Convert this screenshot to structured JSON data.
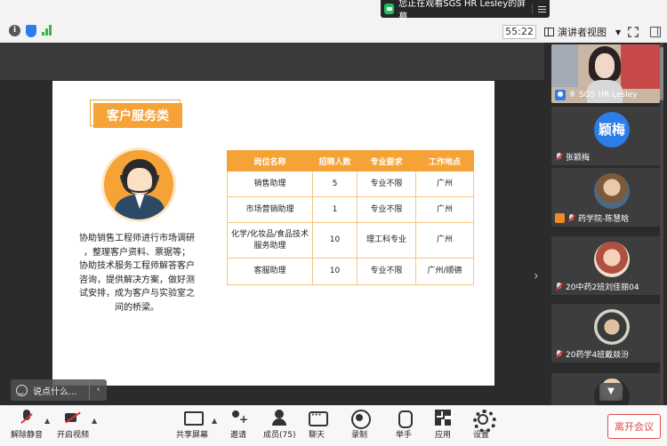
{
  "banner": {
    "text": "您正在观看SGS HR Lesley的屏幕"
  },
  "header": {
    "timer": "55:22",
    "view_mode": "演讲者视图"
  },
  "slide": {
    "title": "客户服务类",
    "description_lines": [
      "协助销售工程师进行市场调研",
      "，整理客户资料、票据等；",
      "协助技术服务工程师解答客户",
      "咨询，提供解决方案，做好测",
      "试安排，成为客户与实验室之",
      "间的桥梁。"
    ],
    "table": {
      "headers": [
        "岗位名称",
        "招聘人数",
        "专业要求",
        "工作地点"
      ],
      "rows": [
        [
          "销售助理",
          "5",
          "专业不限",
          "广州"
        ],
        [
          "市场营销助理",
          "1",
          "专业不限",
          "广州"
        ],
        [
          "化学/化妆品/食品技术服务助理",
          "10",
          "理工科专业",
          "广州"
        ],
        [
          "客服助理",
          "10",
          "专业不限",
          "广州/顺德"
        ]
      ]
    }
  },
  "chat": {
    "placeholder": "说点什么..."
  },
  "participants": [
    {
      "name": "SGS HR Lesley"
    },
    {
      "name": "张颖梅",
      "avatar_text": "颖梅"
    },
    {
      "name": "药学院-陈慧晗"
    },
    {
      "name": "20中药2班刘佳丽04"
    },
    {
      "name": "20药学4班戴燚汾"
    }
  ],
  "toolbar": {
    "unmute": "解除静音",
    "start_video": "开启视频",
    "share_screen": "共享屏幕",
    "invite": "邀请",
    "members": "成员(75)",
    "chat": "聊天",
    "record": "录制",
    "raise_hand": "举手",
    "apps": "应用",
    "settings": "设置",
    "leave": "离开会议"
  },
  "colors": {
    "accent": "#f5a336",
    "host": "#2b7de9",
    "leave": "#e04a4a",
    "muted": "#e03030"
  }
}
